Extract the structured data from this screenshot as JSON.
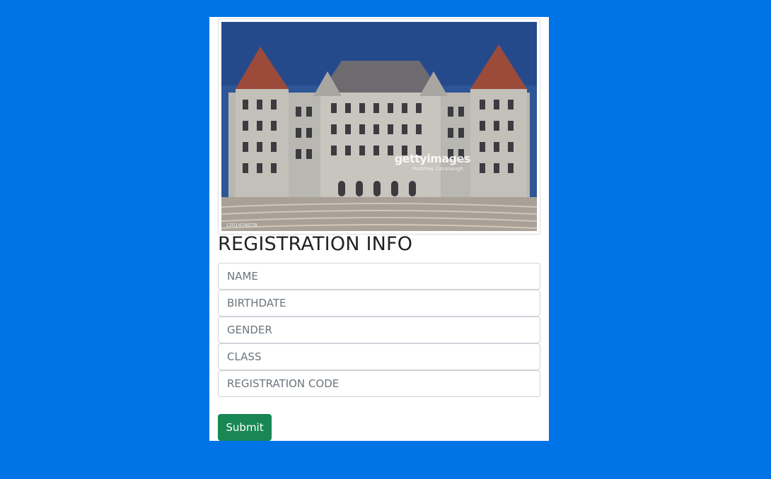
{
  "photo": {
    "description_icon": "government-building-photo",
    "watermark": "gettyimages",
    "watermark_credit": "Matthew Cavanaugh",
    "image_id": "1201476078"
  },
  "form": {
    "title": "REGISTRATION INFO",
    "fields": [
      {
        "placeholder": "NAME",
        "value": ""
      },
      {
        "placeholder": "BIRTHDATE",
        "value": ""
      },
      {
        "placeholder": "GENDER",
        "value": ""
      },
      {
        "placeholder": "CLASS",
        "value": ""
      },
      {
        "placeholder": "REGISTRATION CODE",
        "value": ""
      }
    ],
    "submit_label": "Submit"
  },
  "colors": {
    "background": "#0073e6",
    "card": "#ffffff",
    "submit": "#198754"
  }
}
